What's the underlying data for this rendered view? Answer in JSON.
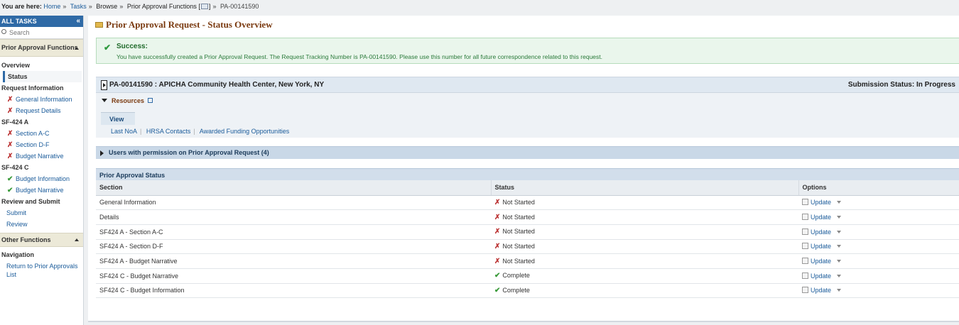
{
  "breadcrumb": {
    "label": "You are here:",
    "items": [
      "Home",
      "Tasks",
      "Browse",
      "Prior Approval Functions"
    ],
    "bracket_open": "[",
    "bracket_close": "]",
    "current": "PA-00141590"
  },
  "sidebar": {
    "header": "ALL TASKS",
    "search_placeholder": "Search",
    "group1": "Prior Approval Functions",
    "overview": "Overview",
    "status": "Status",
    "sec_request_info": "Request Information",
    "general_information": "General Information",
    "request_details": "Request Details",
    "sec_sf424a": "SF-424 A",
    "section_ac": "Section A-C",
    "section_df": "Section D-F",
    "budget_narrative_a": "Budget Narrative",
    "sec_sf424c": "SF-424 C",
    "budget_information_c": "Budget Information",
    "budget_narrative_c": "Budget Narrative",
    "sec_review": "Review and Submit",
    "submit": "Submit",
    "review": "Review",
    "group2": "Other Functions",
    "sec_navigation": "Navigation",
    "return_link": "Return to Prior Approvals List"
  },
  "page": {
    "title": "Prior Approval Request - Status Overview"
  },
  "success": {
    "heading": "Success:",
    "message": "You have successfully created a Prior Approval Request. The Request Tracking Number is PA-00141590. Please use this number for all future correspondence related to this request."
  },
  "request": {
    "title": "PA-00141590 : APICHA Community Health Center, New York, NY",
    "submission_status": "Submission Status: In Progress",
    "resources_label": "Resources",
    "view_tab": "View",
    "links": [
      "Last NoA",
      "HRSA Contacts",
      "Awarded Funding Opportunities"
    ]
  },
  "users_panel": {
    "label": "Users with permission on Prior Approval Request (4)"
  },
  "status_table": {
    "title": "Prior Approval Status",
    "columns": [
      "Section",
      "Status",
      "Options"
    ],
    "rows": [
      {
        "section": "General Information",
        "status": "Not Started",
        "option": "Update"
      },
      {
        "section": "Details",
        "status": "Not Started",
        "option": "Update"
      },
      {
        "section": "SF424 A - Section A-C",
        "status": "Not Started",
        "option": "Update"
      },
      {
        "section": "SF424 A - Section D-F",
        "status": "Not Started",
        "option": "Update"
      },
      {
        "section": "SF424 A - Budget Narrative",
        "status": "Not Started",
        "option": "Update"
      },
      {
        "section": "SF424 C - Budget Narrative",
        "status": "Complete",
        "option": "Update"
      },
      {
        "section": "SF424 C - Budget Information",
        "status": "Complete",
        "option": "Update"
      }
    ]
  },
  "colors": {
    "link": "#1a5b9a",
    "header_blue": "#2f6aa6",
    "title_brown": "#7a3a10",
    "success_green": "#2e9a3e",
    "not_started_red": "#b33"
  }
}
